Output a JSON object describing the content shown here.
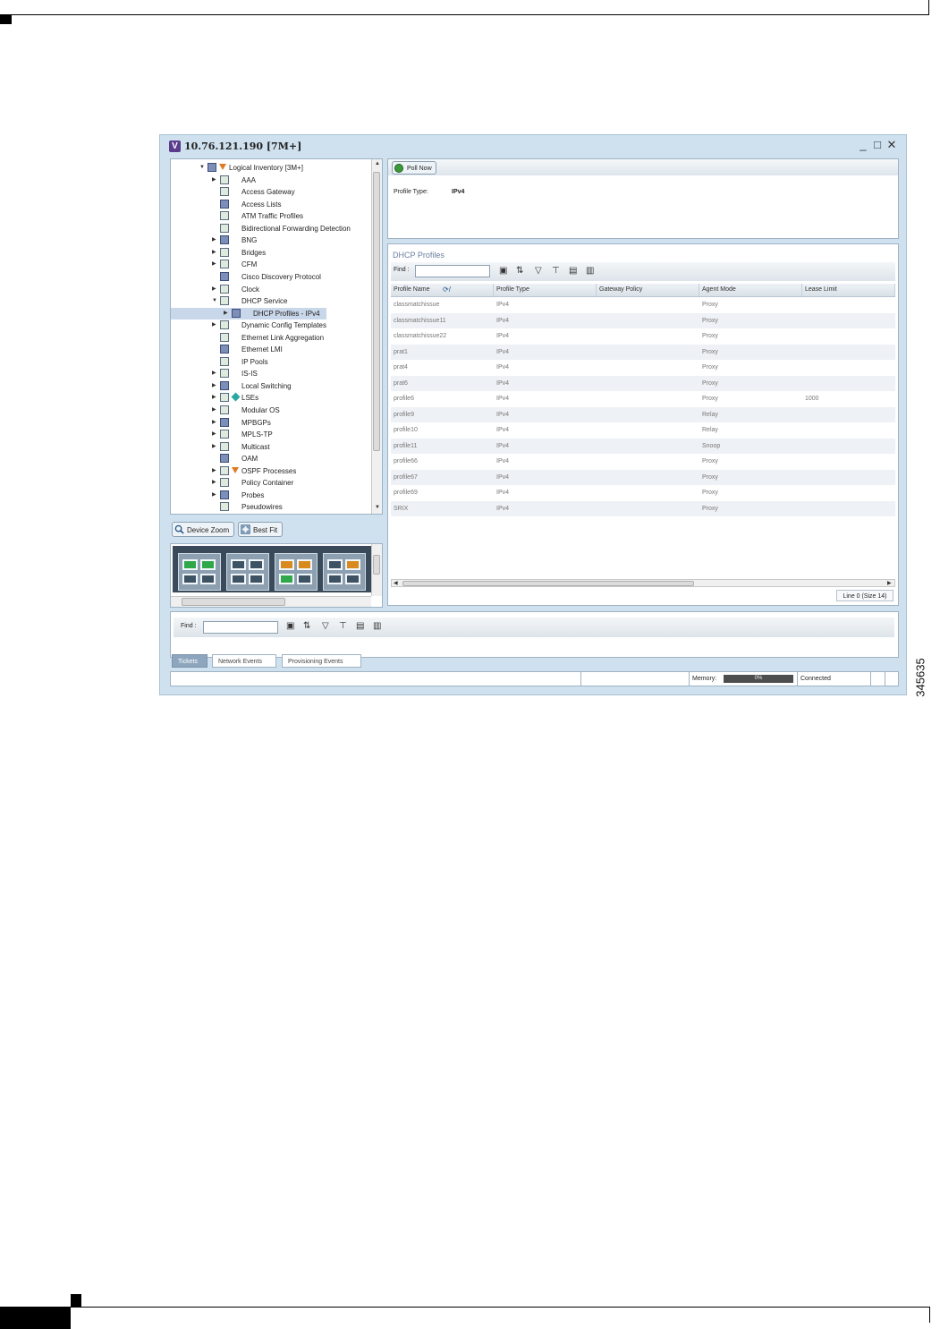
{
  "window": {
    "title": "10.76.121.190 [7M+]",
    "logo_letter": "V"
  },
  "tree": {
    "items": [
      {
        "label": "Logical Inventory [3M+]",
        "level": 0,
        "expander": "▼",
        "badge": "alarm-down"
      },
      {
        "label": "AAA",
        "level": 1,
        "expander": "▶"
      },
      {
        "label": "Access Gateway",
        "level": 1
      },
      {
        "label": "Access Lists",
        "level": 1
      },
      {
        "label": "ATM Traffic Profiles",
        "level": 1
      },
      {
        "label": "Bidirectional Forwarding Detection",
        "level": 1
      },
      {
        "label": "BNG",
        "level": 1,
        "expander": "▶"
      },
      {
        "label": "Bridges",
        "level": 1,
        "expander": "▶"
      },
      {
        "label": "CFM",
        "level": 1,
        "expander": "▶"
      },
      {
        "label": "Cisco Discovery Protocol",
        "level": 1
      },
      {
        "label": "Clock",
        "level": 1,
        "expander": "▶"
      },
      {
        "label": "DHCP Service",
        "level": 1,
        "expander": "▼"
      },
      {
        "label": "DHCP Profiles - IPv4",
        "level": 2,
        "expander": "▶",
        "selected": true
      },
      {
        "label": "Dynamic Config Templates",
        "level": 1,
        "expander": "▶"
      },
      {
        "label": "Ethernet Link Aggregation",
        "level": 1
      },
      {
        "label": "Ethernet LMI",
        "level": 1
      },
      {
        "label": "IP Pools",
        "level": 1
      },
      {
        "label": "IS-IS",
        "level": 1,
        "expander": "▶"
      },
      {
        "label": "Local Switching",
        "level": 1,
        "expander": "▶"
      },
      {
        "label": "LSEs",
        "level": 1,
        "expander": "▶",
        "badge": "dot"
      },
      {
        "label": "Modular OS",
        "level": 1,
        "expander": "▶"
      },
      {
        "label": "MPBGPs",
        "level": 1,
        "expander": "▶"
      },
      {
        "label": "MPLS-TP",
        "level": 1,
        "expander": "▶"
      },
      {
        "label": "Multicast",
        "level": 1,
        "expander": "▶"
      },
      {
        "label": "OAM",
        "level": 1
      },
      {
        "label": "OSPF Processes",
        "level": 1,
        "expander": "▶",
        "badge": "alarm-down"
      },
      {
        "label": "Policy Container",
        "level": 1,
        "expander": "▶"
      },
      {
        "label": "Probes",
        "level": 1,
        "expander": "▶"
      },
      {
        "label": "Pseudowires",
        "level": 1
      }
    ]
  },
  "device_toolbar": {
    "zoom_label": "Device Zoom",
    "fit_label": "Best Fit"
  },
  "properties": {
    "poll_label": "Poll Now",
    "profile_type_label": "Profile Type:",
    "profile_type_value": "IPv4"
  },
  "dhcp": {
    "section_title": "DHCP Profiles",
    "find_label": "Find :",
    "columns": [
      "Profile Name",
      "Profile Type",
      "Gateway Policy",
      "Agent Mode",
      "Lease Limit"
    ],
    "rows": [
      [
        "classmatchissue",
        "IPv4",
        "",
        "Proxy",
        ""
      ],
      [
        "classmatchissue11",
        "IPv4",
        "",
        "Proxy",
        ""
      ],
      [
        "classmatchissue22",
        "IPv4",
        "",
        "Proxy",
        ""
      ],
      [
        "prat1",
        "IPv4",
        "",
        "Proxy",
        ""
      ],
      [
        "prat4",
        "IPv4",
        "",
        "Proxy",
        ""
      ],
      [
        "prat6",
        "IPv4",
        "",
        "Proxy",
        ""
      ],
      [
        "profile6",
        "IPv4",
        "",
        "Proxy",
        "1000"
      ],
      [
        "profile9",
        "IPv4",
        "",
        "Relay",
        ""
      ],
      [
        "profile10",
        "IPv4",
        "",
        "Relay",
        ""
      ],
      [
        "profile11",
        "IPv4",
        "",
        "Snoop",
        ""
      ],
      [
        "profile66",
        "IPv4",
        "",
        "Proxy",
        ""
      ],
      [
        "profile67",
        "IPv4",
        "",
        "Proxy",
        ""
      ],
      [
        "profile69",
        "IPv4",
        "",
        "Proxy",
        ""
      ],
      [
        "SRIX",
        "IPv4",
        "",
        "Proxy",
        ""
      ]
    ],
    "status": "Line 0 (Size 14)"
  },
  "bottom": {
    "find_label": "Find :",
    "tabs": [
      "Tickets",
      "Network Events",
      "Provisioning Events"
    ],
    "active_tab": "Tickets"
  },
  "statusbar": {
    "memory_label": "Memory:",
    "memory_value": "0%",
    "connection": "Connected"
  },
  "figure_number": "345635",
  "colors": {
    "window_bg": "#cfe1ee",
    "accent": "#8ea6bd",
    "alarm": "#e07a22"
  }
}
